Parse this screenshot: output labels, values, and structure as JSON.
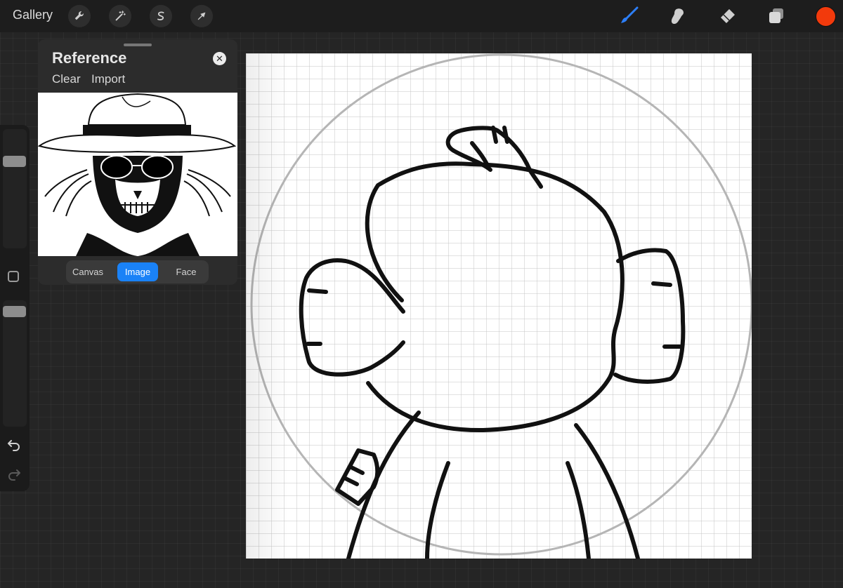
{
  "toolbar": {
    "gallery_label": "Gallery",
    "actions_icon": "wrench-icon",
    "adjustments_icon": "magic-wand-icon",
    "selection_icon": "selection-icon",
    "transform_icon": "arrow-cursor-icon",
    "brush_icon": "brush-icon",
    "smudge_icon": "smudge-icon",
    "eraser_icon": "eraser-icon",
    "layers_icon": "layers-icon",
    "current_color": "#f23a0c",
    "brush_color": "#2d7ff9"
  },
  "reference": {
    "title": "Reference",
    "clear_label": "Clear",
    "import_label": "Import",
    "close_icon": "close-icon",
    "tabs": [
      {
        "label": "Canvas",
        "active": false
      },
      {
        "label": "Image",
        "active": true
      },
      {
        "label": "Face",
        "active": false
      }
    ],
    "accent": "#1a82f7"
  },
  "sidebar": {
    "undo_icon": "undo-icon",
    "redo_icon": "redo-icon",
    "modify_icon": "square-icon"
  }
}
